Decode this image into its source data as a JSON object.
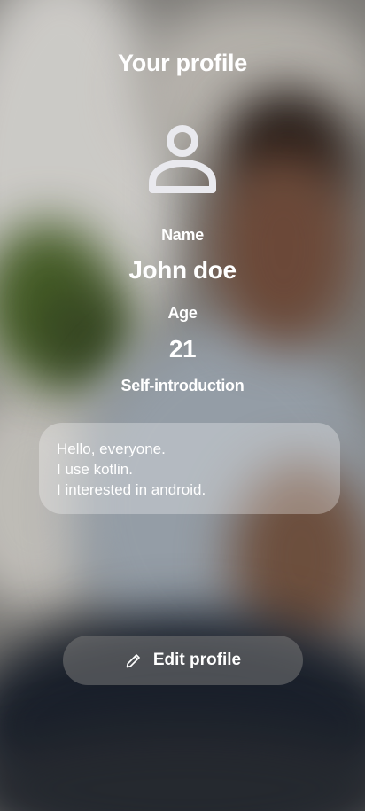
{
  "header": {
    "title": "Your profile"
  },
  "avatar": {
    "icon": "person-icon"
  },
  "profile": {
    "name_label": "Name",
    "name_value": "John doe",
    "age_label": "Age",
    "age_value": "21",
    "intro_label": "Self-introduction",
    "intro_lines": [
      "Hello, everyone.",
      "I use kotlin.",
      "I interested in android."
    ]
  },
  "actions": {
    "edit_label": "Edit profile",
    "edit_icon": "pencil-icon"
  }
}
